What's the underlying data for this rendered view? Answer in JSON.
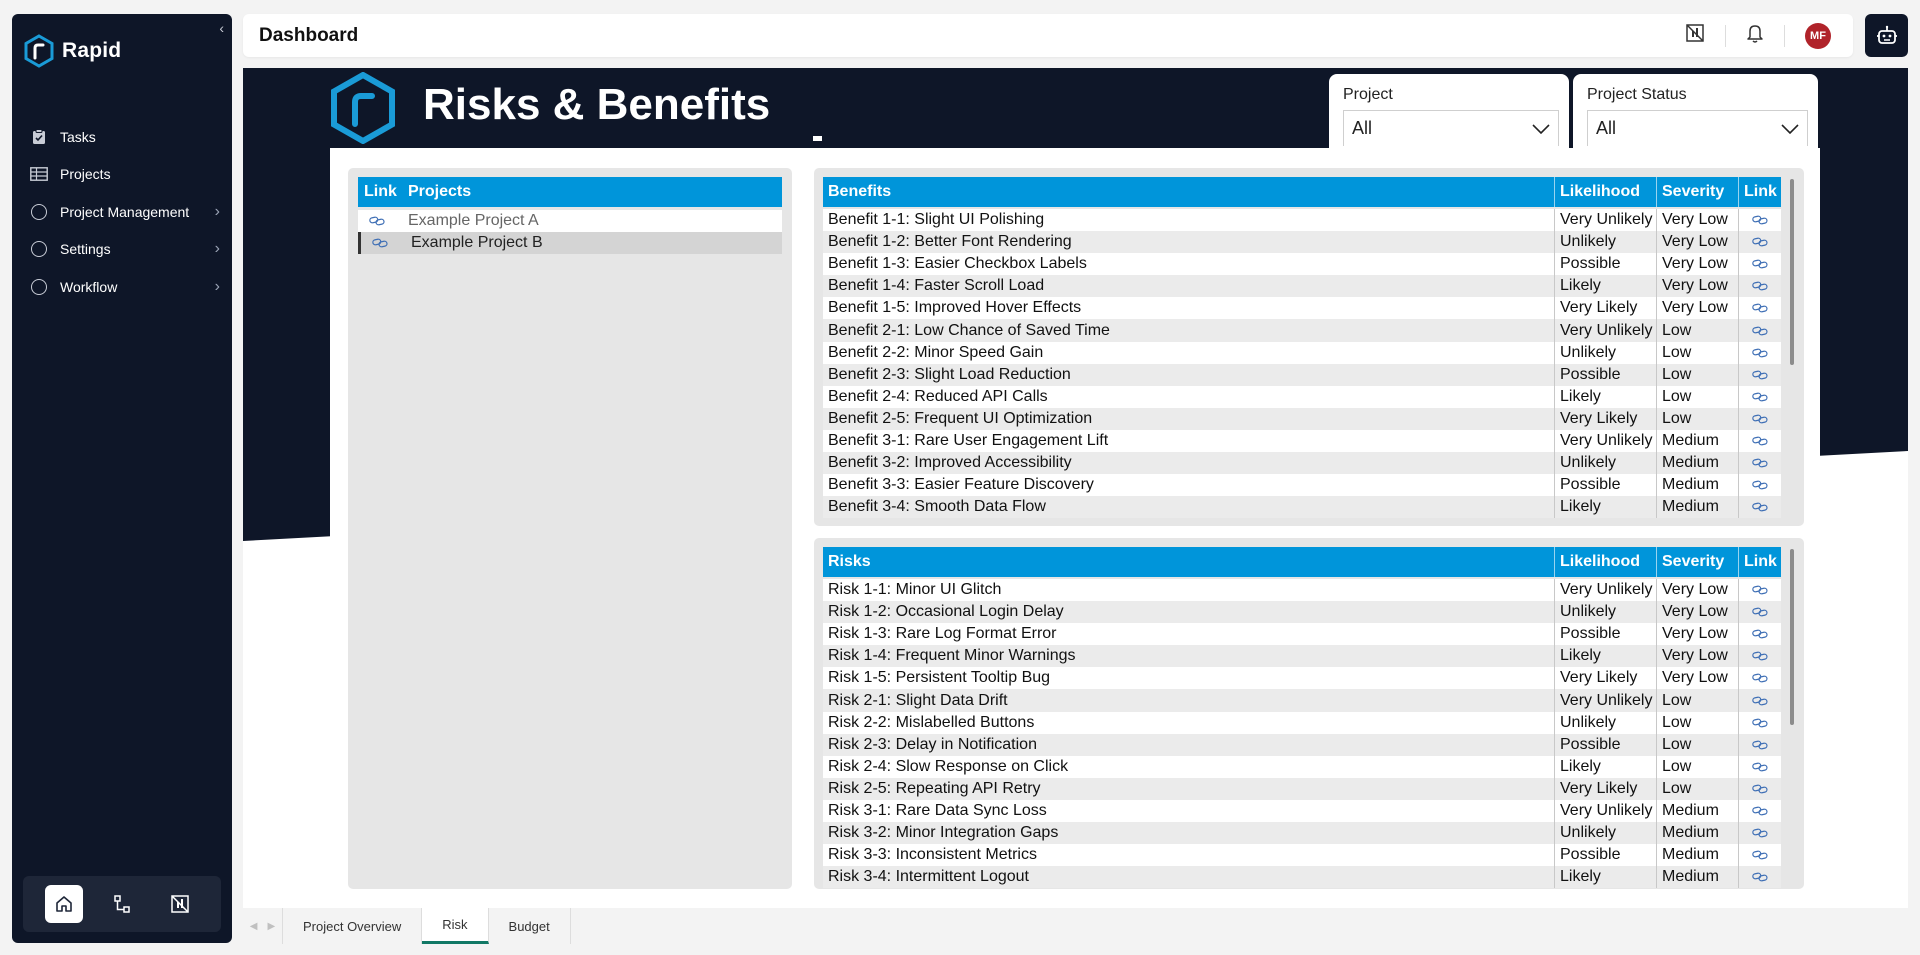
{
  "sidebar": {
    "brand": "Rapid",
    "items": [
      {
        "label": "Tasks",
        "icon": "tasks-icon",
        "has_children": false
      },
      {
        "label": "Projects",
        "icon": "projects-icon",
        "has_children": false
      },
      {
        "label": "Project Management",
        "icon": "circle-icon",
        "has_children": true
      },
      {
        "label": "Settings",
        "icon": "circle-icon",
        "has_children": true
      },
      {
        "label": "Workflow",
        "icon": "circle-icon",
        "has_children": true
      }
    ],
    "bottom_buttons": [
      "home-icon",
      "workflow-icon",
      "report-icon"
    ]
  },
  "header": {
    "title": "Dashboard",
    "avatar_initials": "MF"
  },
  "report": {
    "title": "Risks & Benefits",
    "slicers": [
      {
        "label": "Project",
        "value": "All"
      },
      {
        "label": "Project Status",
        "value": "All"
      }
    ],
    "projects_table": {
      "headers": [
        "Link",
        "Projects"
      ],
      "rows": [
        "Example Project A",
        "Example Project B"
      ],
      "selected_index": 1
    },
    "benefits_table": {
      "headers": [
        "Benefits",
        "Likelihood",
        "Severity",
        "Link"
      ],
      "rows": [
        [
          "Benefit 1-1: Slight UI Polishing",
          "Very Unlikely",
          "Very Low"
        ],
        [
          "Benefit 1-2: Better Font Rendering",
          "Unlikely",
          "Very Low"
        ],
        [
          "Benefit 1-3: Easier Checkbox Labels",
          "Possible",
          "Very Low"
        ],
        [
          "Benefit 1-4: Faster Scroll Load",
          "Likely",
          "Very Low"
        ],
        [
          "Benefit 1-5: Improved Hover Effects",
          "Very Likely",
          "Very Low"
        ],
        [
          "Benefit 2-1: Low Chance of Saved Time",
          "Very Unlikely",
          "Low"
        ],
        [
          "Benefit 2-2: Minor Speed Gain",
          "Unlikely",
          "Low"
        ],
        [
          "Benefit 2-3: Slight Load Reduction",
          "Possible",
          "Low"
        ],
        [
          "Benefit 2-4: Reduced API Calls",
          "Likely",
          "Low"
        ],
        [
          "Benefit 2-5: Frequent UI Optimization",
          "Very Likely",
          "Low"
        ],
        [
          "Benefit 3-1: Rare User Engagement Lift",
          "Very Unlikely",
          "Medium"
        ],
        [
          "Benefit 3-2: Improved Accessibility",
          "Unlikely",
          "Medium"
        ],
        [
          "Benefit 3-3: Easier Feature Discovery",
          "Possible",
          "Medium"
        ],
        [
          "Benefit 3-4: Smooth Data Flow",
          "Likely",
          "Medium"
        ]
      ]
    },
    "risks_table": {
      "headers": [
        "Risks",
        "Likelihood",
        "Severity",
        "Link"
      ],
      "rows": [
        [
          "Risk 1-1: Minor UI Glitch",
          "Very Unlikely",
          "Very Low"
        ],
        [
          "Risk 1-2: Occasional Login Delay",
          "Unlikely",
          "Very Low"
        ],
        [
          "Risk 1-3: Rare Log Format Error",
          "Possible",
          "Very Low"
        ],
        [
          "Risk 1-4: Frequent Minor Warnings",
          "Likely",
          "Very Low"
        ],
        [
          "Risk 1-5: Persistent Tooltip Bug",
          "Very Likely",
          "Very Low"
        ],
        [
          "Risk 2-1: Slight Data Drift",
          "Very Unlikely",
          "Low"
        ],
        [
          "Risk 2-2: Mislabelled Buttons",
          "Unlikely",
          "Low"
        ],
        [
          "Risk 2-3: Delay in Notification",
          "Possible",
          "Low"
        ],
        [
          "Risk 2-4: Slow Response on Click",
          "Likely",
          "Low"
        ],
        [
          "Risk 2-5: Repeating API Retry",
          "Very Likely",
          "Low"
        ],
        [
          "Risk 3-1: Rare Data Sync Loss",
          "Very Unlikely",
          "Medium"
        ],
        [
          "Risk 3-2: Minor Integration Gaps",
          "Unlikely",
          "Medium"
        ],
        [
          "Risk 3-3: Inconsistent Metrics",
          "Possible",
          "Medium"
        ],
        [
          "Risk 3-4: Intermittent Logout",
          "Likely",
          "Medium"
        ]
      ]
    }
  },
  "page_tabs": {
    "items": [
      "Project Overview",
      "Risk",
      "Budget"
    ],
    "active_index": 1
  },
  "colors": {
    "sidebar_bg": "#0e1628",
    "table_header": "#0095da",
    "brand_blue": "#1a9bd7",
    "active_tab_underline": "#117865",
    "avatar_bg": "#b0232a"
  }
}
